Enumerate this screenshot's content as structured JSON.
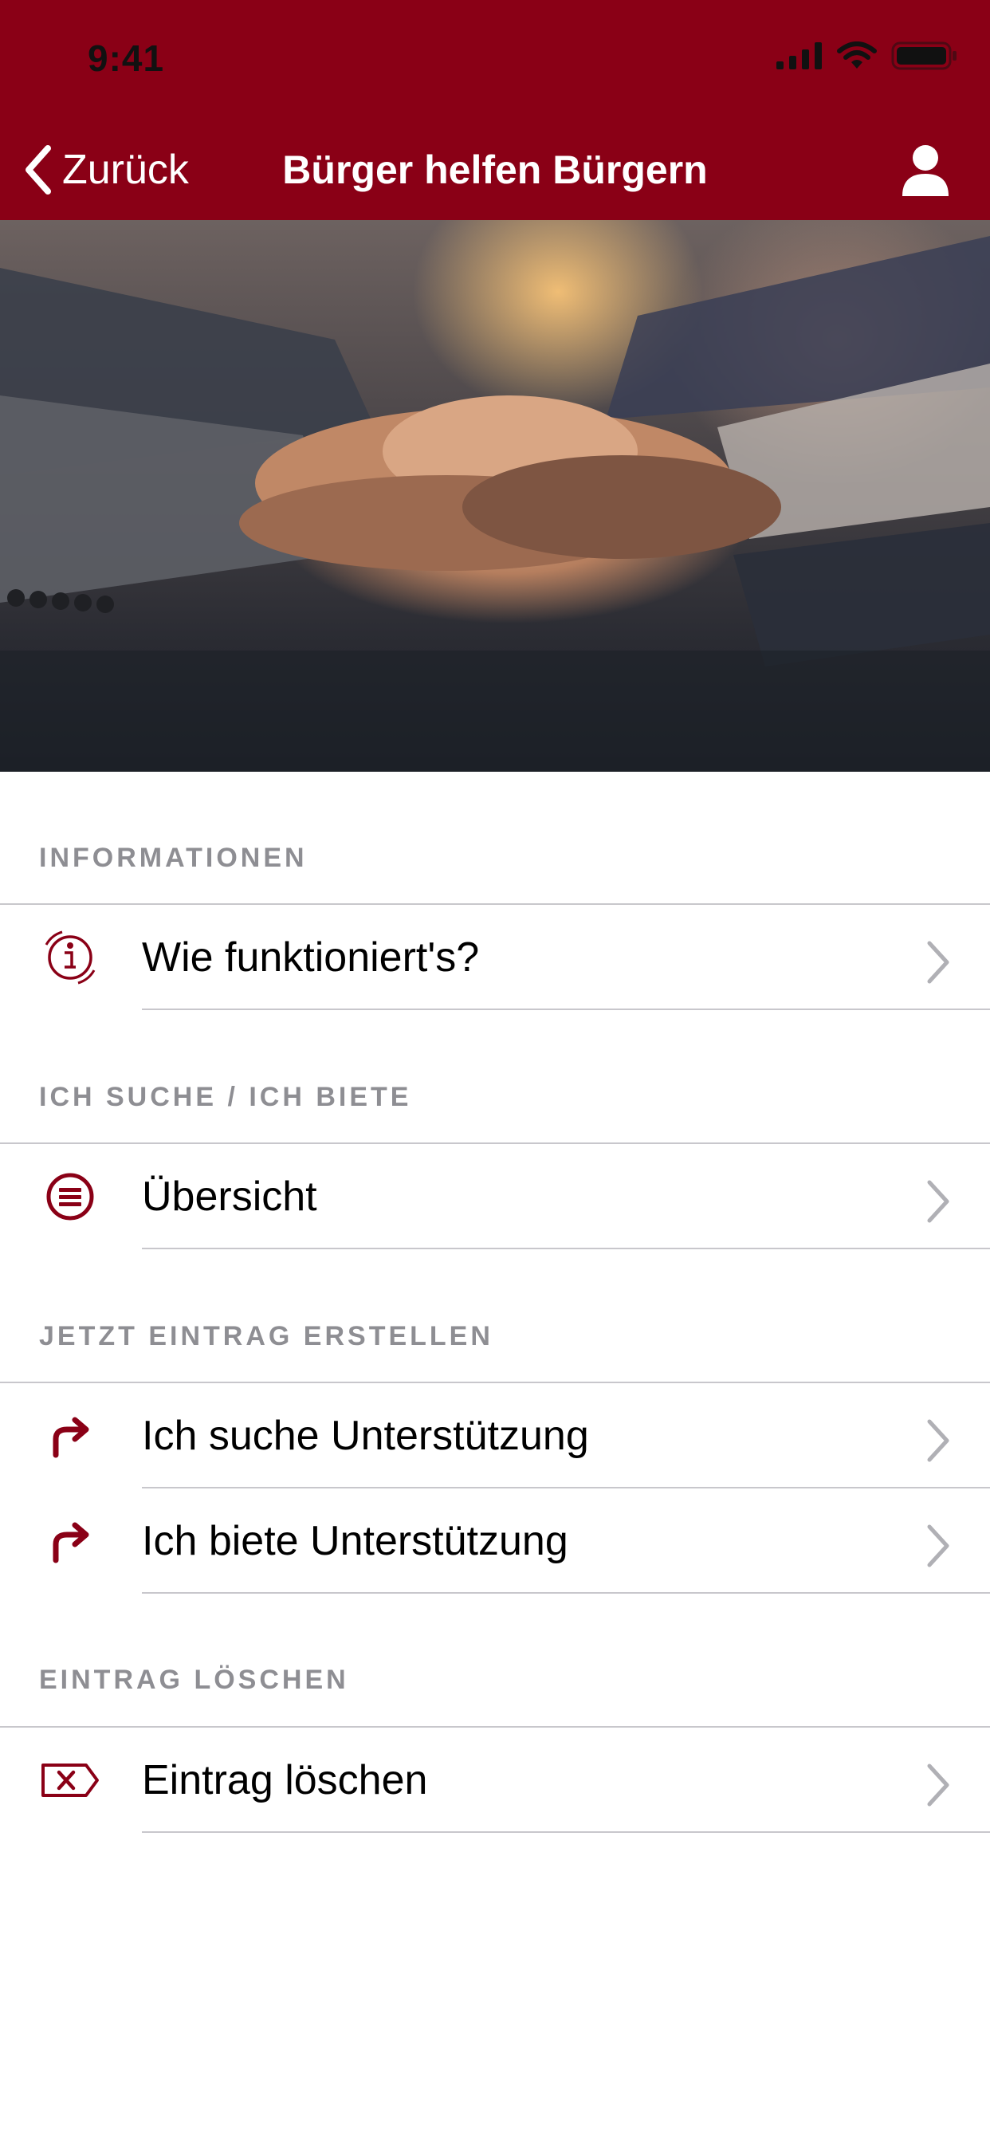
{
  "status_bar": {
    "time": "9:41"
  },
  "nav": {
    "back_label": "Zurück",
    "title": "Bürger helfen Bürgern"
  },
  "accent_color": "#8a0016",
  "sections": [
    {
      "header": "INFORMATIONEN",
      "items": [
        {
          "label": "Wie funktioniert's?",
          "icon": "info-icon"
        }
      ]
    },
    {
      "header": "ICH SUCHE / ICH BIETE",
      "items": [
        {
          "label": "Übersicht",
          "icon": "list-icon"
        }
      ]
    },
    {
      "header": "JETZT EINTRAG ERSTELLEN",
      "items": [
        {
          "label": "Ich suche Unterstützung",
          "icon": "forward-arrow-icon"
        },
        {
          "label": "Ich biete Unterstützung",
          "icon": "forward-arrow-icon"
        }
      ]
    },
    {
      "header": "EINTRAG LÖSCHEN",
      "items": [
        {
          "label": "Eintrag löschen",
          "icon": "delete-tag-icon"
        }
      ]
    }
  ]
}
